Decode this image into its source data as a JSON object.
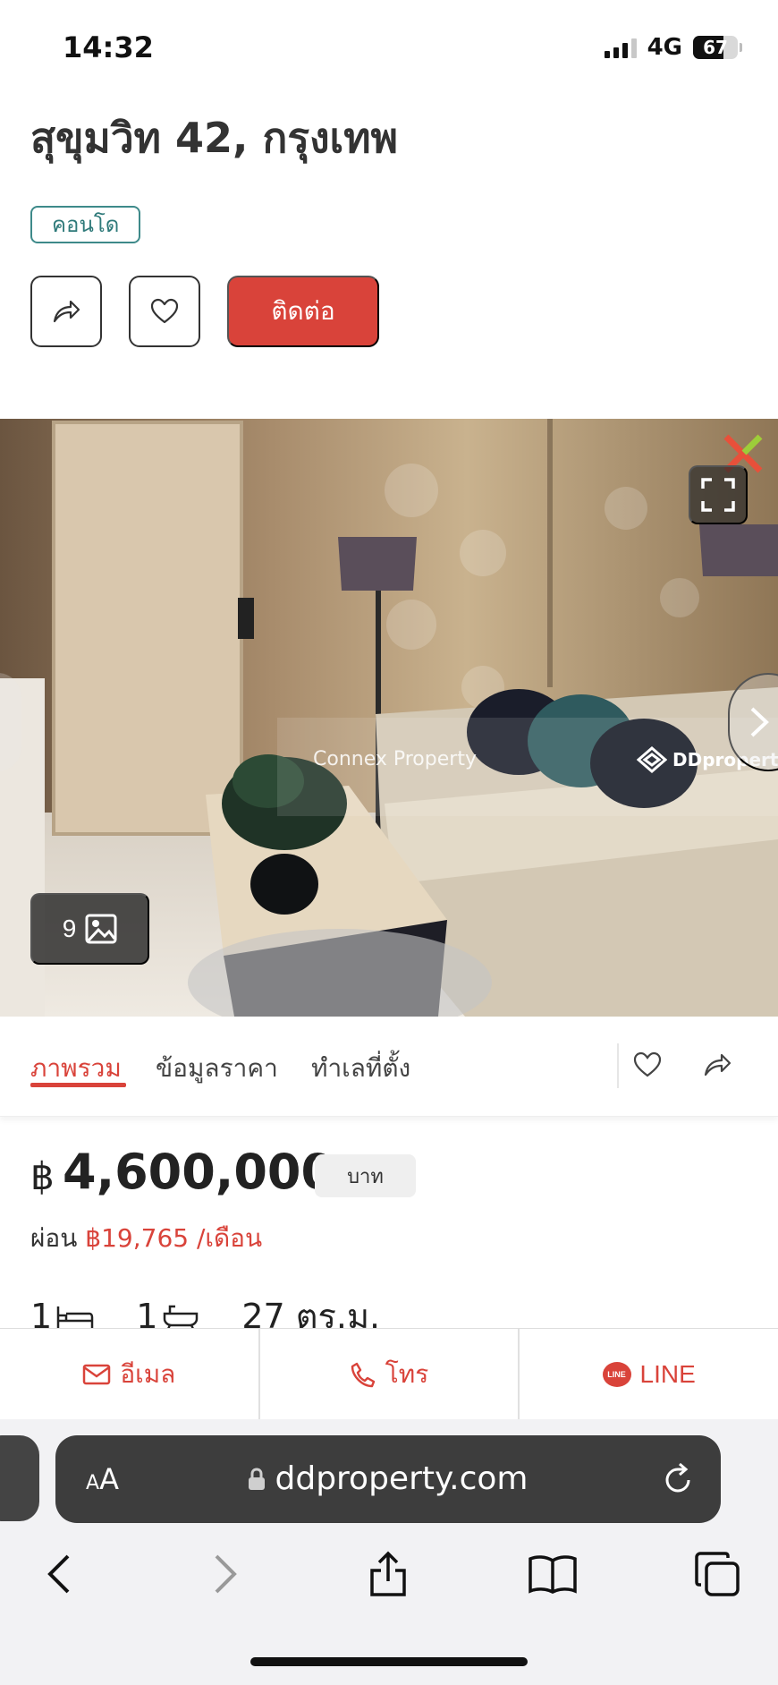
{
  "status_bar": {
    "time": "14:32",
    "network": "4G",
    "battery": "67",
    "battery_level": 0.67
  },
  "listing": {
    "title": "สุขุมวิท 42, กรุงเทพ",
    "type_badge": "คอนโด",
    "contact_label": "ติดต่อ"
  },
  "photo": {
    "count": "9",
    "watermark_agency": "Connex Property",
    "watermark_site": "DDproperty"
  },
  "tabs": [
    {
      "label": "ภาพรวม",
      "active": true
    },
    {
      "label": "ข้อมูลราคา",
      "active": false
    },
    {
      "label": "ทำเลที่ตั้ง",
      "active": false
    }
  ],
  "price": {
    "currency_symbol": "฿",
    "amount": "4,600,000",
    "unit": "บาท",
    "installment_label": "ผ่อน",
    "installment_amount": "฿19,765 /เดือน"
  },
  "specs": {
    "bedrooms": "1",
    "bathrooms": "1",
    "area": "27 ตร.ม."
  },
  "actions": {
    "email": "อีเมล",
    "call": "โทร",
    "line": "LINE",
    "line_icon_text": "LINE"
  },
  "browser": {
    "text_size_label": "AA",
    "url": "ddproperty.com"
  },
  "colors": {
    "accent": "#d9433a",
    "badge_teal": "#2f7a7a",
    "url_bar": "#3d3d3d"
  },
  "icons": [
    "share-icon",
    "heart-icon",
    "fullscreen-icon",
    "gallery-icon",
    "chevron-right-icon",
    "bed-icon",
    "bath-icon",
    "mail-icon",
    "phone-icon",
    "line-icon",
    "lock-icon",
    "reload-icon",
    "back-icon",
    "forward-icon",
    "share-sheet-icon",
    "bookmarks-icon",
    "tabs-icon"
  ]
}
